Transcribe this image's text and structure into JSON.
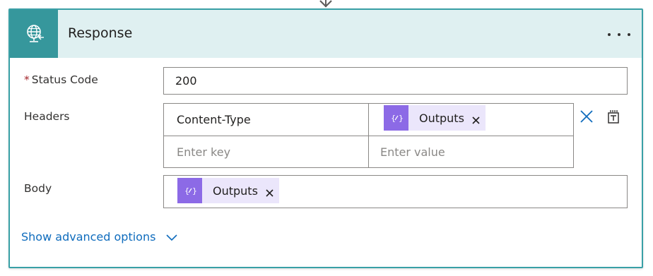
{
  "connector": {
    "icon": "chevron-down-icon"
  },
  "action": {
    "title": "Response",
    "icon": "web-globe-icon",
    "accent_color": "#36979c",
    "header_bg": "#dff0f1",
    "more_icon": "ellipsis-icon"
  },
  "status_code": {
    "label": "Status Code",
    "required_mark": "*",
    "value": "200"
  },
  "headers": {
    "label": "Headers",
    "rows": [
      {
        "key": "Content-Type",
        "value_token": {
          "label": "Outputs",
          "icon": "expression-icon"
        }
      }
    ],
    "key_placeholder": "Enter key",
    "value_placeholder": "Enter value",
    "actions": {
      "delete_icon": "close-icon",
      "text_mode_icon": "switch-to-text-mode-icon"
    }
  },
  "body": {
    "label": "Body",
    "token": {
      "label": "Outputs",
      "icon": "expression-icon",
      "color": "#8c6ae6"
    }
  },
  "advanced": {
    "label": "Show advanced options",
    "icon": "chevron-down-icon"
  }
}
